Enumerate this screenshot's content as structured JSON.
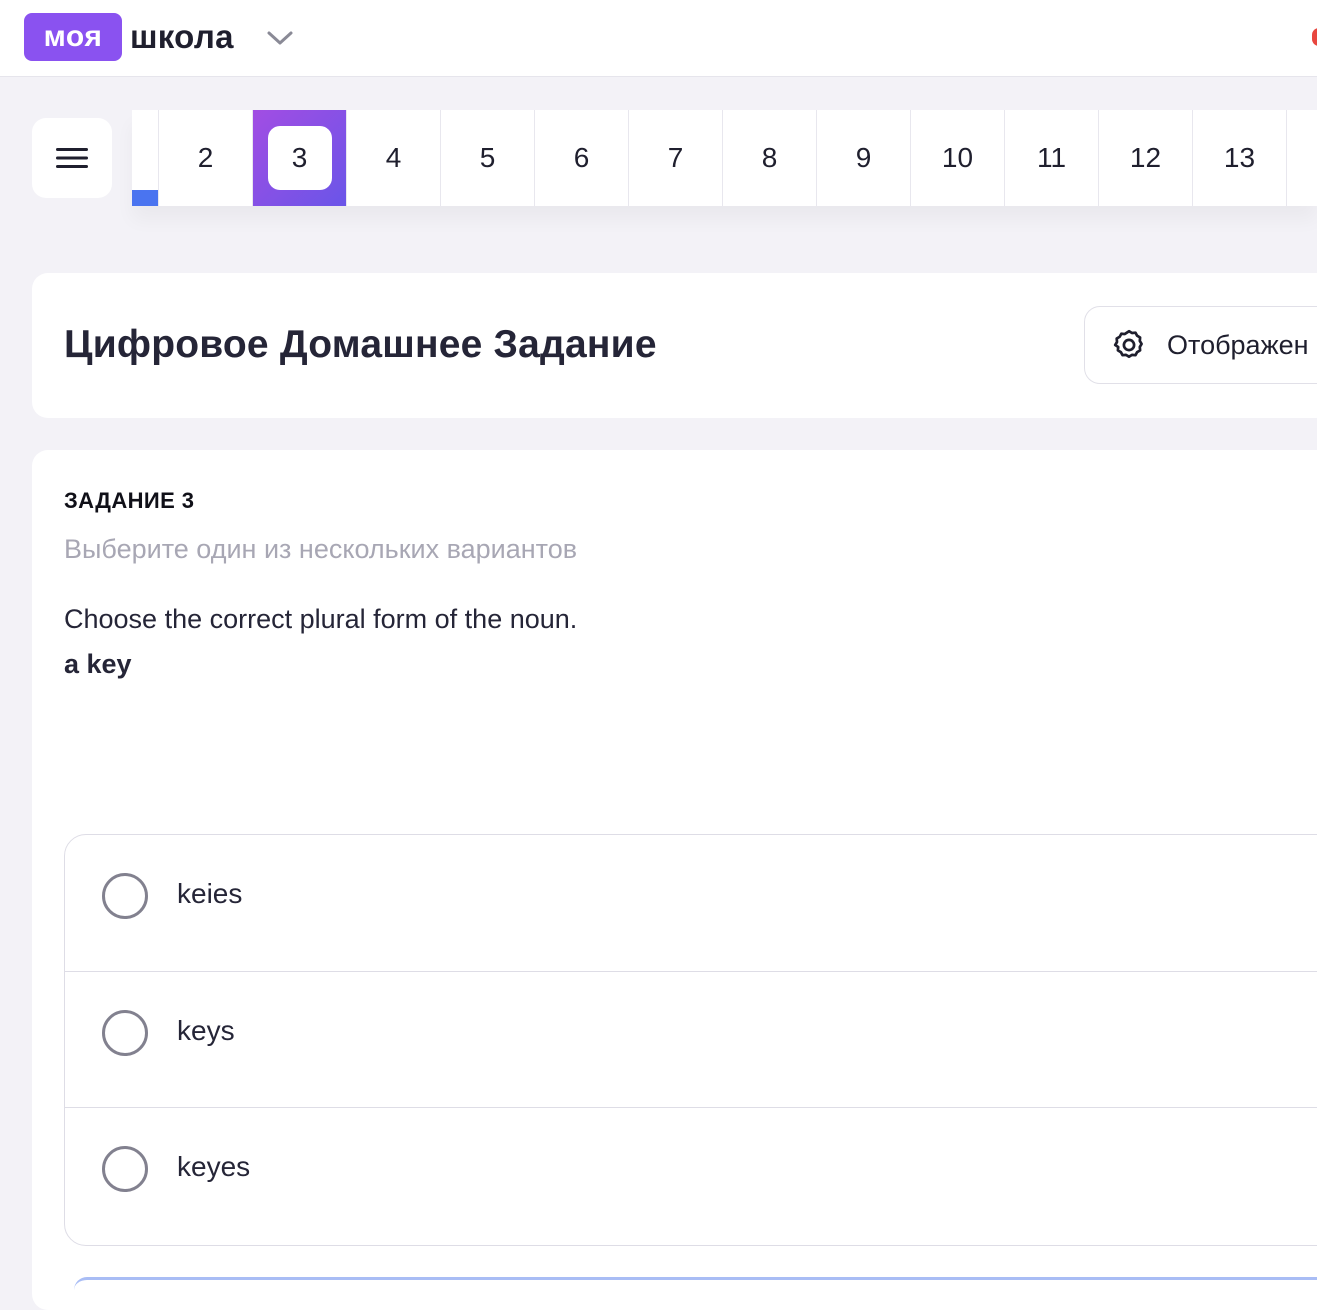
{
  "header": {
    "logo_badge": "моя",
    "logo_word": "школа",
    "brand_color": "#8a52f0"
  },
  "nav": {
    "menu_icon": "hamburger-menu-icon",
    "tasks": [
      {
        "label": "2",
        "active": false
      },
      {
        "label": "3",
        "active": true
      },
      {
        "label": "4",
        "active": false
      },
      {
        "label": "5",
        "active": false
      },
      {
        "label": "6",
        "active": false
      },
      {
        "label": "7",
        "active": false
      },
      {
        "label": "8",
        "active": false
      },
      {
        "label": "9",
        "active": false
      },
      {
        "label": "10",
        "active": false
      },
      {
        "label": "11",
        "active": false
      },
      {
        "label": "12",
        "active": false
      },
      {
        "label": "13",
        "active": false
      }
    ],
    "active_gradient": [
      "#a24de3",
      "#6a55e8"
    ],
    "progress_color": "#4a74f0"
  },
  "page": {
    "title": "Цифровое Домашнее Задание",
    "display_button_label": "Отображен",
    "display_button_icon": "gear-icon"
  },
  "task": {
    "label": "ЗАДАНИЕ 3",
    "instruction": "Выберите один из нескольких вариантов",
    "question": "Choose the correct plural form of the noun.",
    "word": "a key",
    "options": [
      {
        "text": "keies",
        "selected": false
      },
      {
        "text": "keys",
        "selected": false
      },
      {
        "text": "keyes",
        "selected": false
      }
    ]
  }
}
